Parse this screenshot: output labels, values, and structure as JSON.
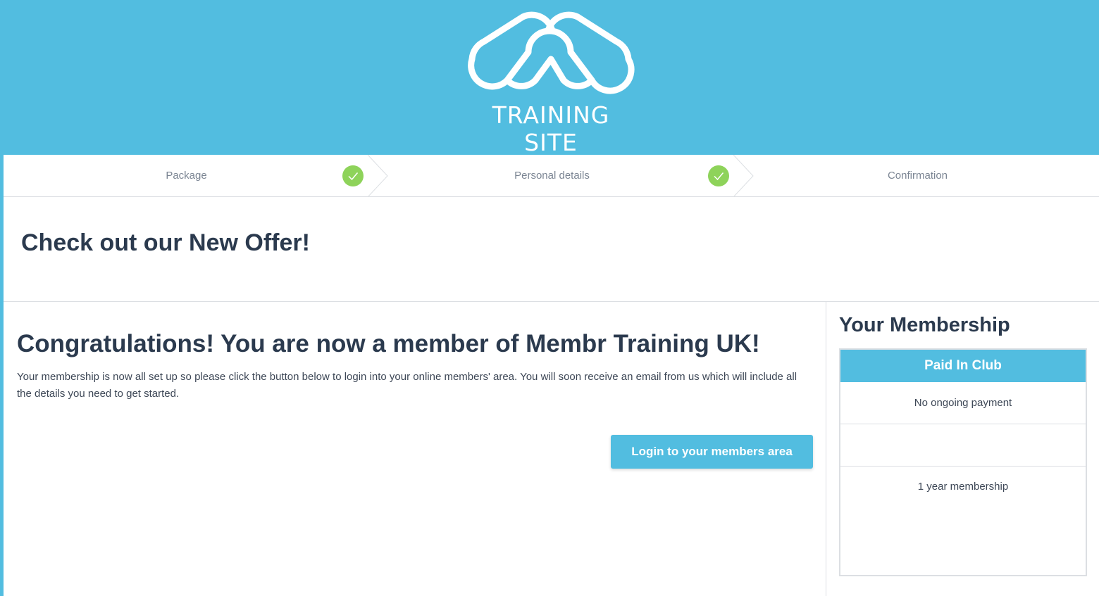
{
  "brand": {
    "logo_text": "TRAINING SITE"
  },
  "steps": [
    {
      "label": "Package",
      "completed": true
    },
    {
      "label": "Personal details",
      "completed": true
    },
    {
      "label": "Confirmation",
      "completed": false
    }
  ],
  "offer": {
    "title": "Check out our New Offer!"
  },
  "main": {
    "heading": "Congratulations! You are now a member of Membr Training UK!",
    "text": "Your membership is now all set up so please click the button below to login into your online members' area. You will soon receive an email from us which will include all the details you need to get started.",
    "login_button": "Login to your members area"
  },
  "membership": {
    "title": "Your Membership",
    "plan_name": "Paid In Club",
    "payment": "No ongoing payment",
    "duration": "1 year membership"
  },
  "colors": {
    "accent": "#52bde0",
    "check": "#8ed35a",
    "text": "#2b3a4e"
  }
}
